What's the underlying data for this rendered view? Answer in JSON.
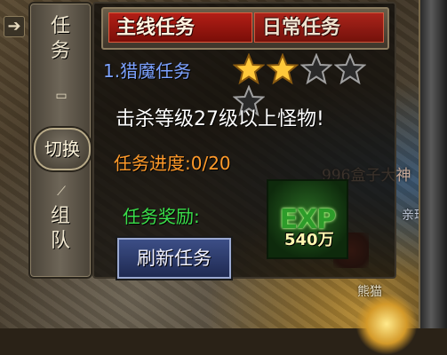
{
  "side": {
    "tab_quest": "任\n务",
    "switch_label": "切换",
    "tab_team": "组\n队"
  },
  "panel": {
    "tabs": {
      "main": "主线任务",
      "daily": "日常任务"
    },
    "quest_name": "1.猎魔任务",
    "stars": {
      "filled": 2,
      "total": 5,
      "colors": {
        "filled": "#ffc83a",
        "empty": "#2a2a2a"
      }
    },
    "objective": "击杀等级27级以上怪物!",
    "progress_label": "任务进度:0/20",
    "reward_label": "任务奖励:",
    "reward": {
      "icon_text": "EXP",
      "amount": "540万"
    },
    "refresh_button": "刷新任务"
  },
  "world": {
    "guild_text": "996盒子大神",
    "player_name": "熊猫",
    "side_name": "亲珠("
  },
  "icons": [
    "collapse-arrow-icon",
    "scroll-icon",
    "sword-icon",
    "star-icon"
  ]
}
